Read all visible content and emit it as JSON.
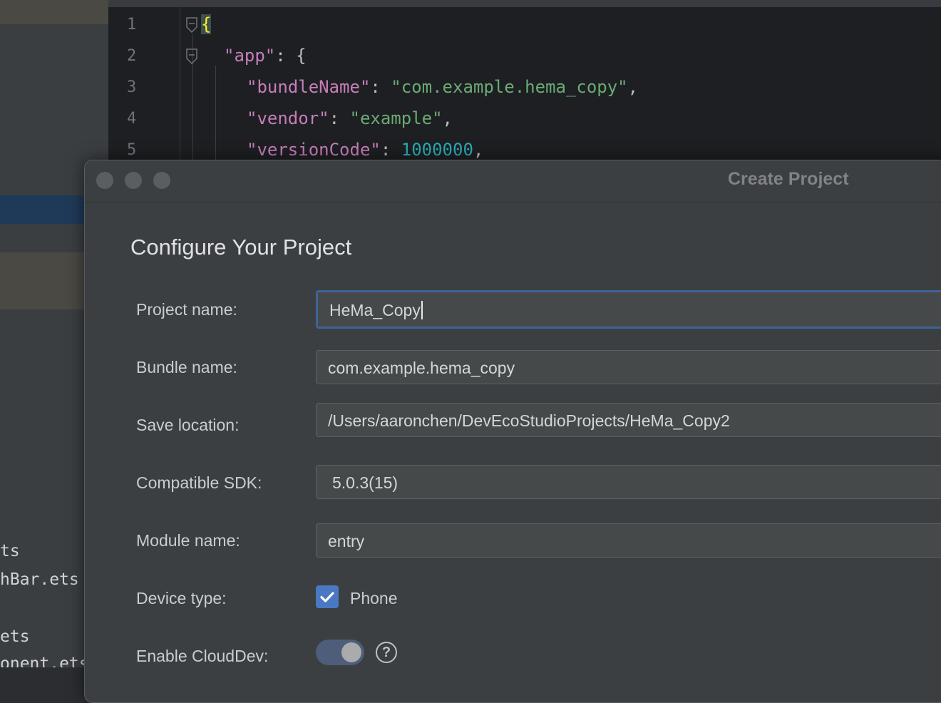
{
  "project_panel": {
    "files": [
      "ts",
      "hBar.ets",
      "ets",
      "onent.ets"
    ]
  },
  "editor": {
    "line_numbers": [
      "1",
      "2",
      "3",
      "4",
      "5"
    ],
    "code": {
      "l1_brace": "{",
      "l2_key": "\"app\"",
      "l2_colon": ": ",
      "l2_brace": "{",
      "l3_key": "\"bundleName\"",
      "l3_colon": ": ",
      "l3_value": "\"com.example.hema_copy\"",
      "l3_comma": ",",
      "l4_key": "\"vendor\"",
      "l4_colon": ": ",
      "l4_value": "\"example\"",
      "l4_comma": ",",
      "l5_key": "\"versionCode\"",
      "l5_colon": ": ",
      "l5_value": "1000000",
      "l5_comma": ","
    }
  },
  "dialog": {
    "title": "Create Project",
    "heading": "Configure Your Project",
    "fields": {
      "project_name": {
        "label": "Project name:",
        "value": "HeMa_Copy"
      },
      "bundle_name": {
        "label": "Bundle name:",
        "value": "com.example.hema_copy"
      },
      "save_location": {
        "label": "Save location:",
        "value": "/Users/aaronchen/DevEcoStudioProjects/HeMa_Copy2"
      },
      "compatible_sdk": {
        "label": "Compatible SDK:",
        "value": "5.0.3(15)"
      },
      "module_name": {
        "label": "Module name:",
        "value": "entry"
      },
      "device_type": {
        "label": "Device type:",
        "option": "Phone",
        "checked": true
      },
      "enable_clouddev": {
        "label": "Enable CloudDev:",
        "enabled": true,
        "help_glyph": "?"
      }
    }
  },
  "colors": {
    "accent": "#4a78c2",
    "focus_border": "#3e6496",
    "string": "#6aab73",
    "key": "#c77dbb",
    "number": "#2aacb8"
  }
}
